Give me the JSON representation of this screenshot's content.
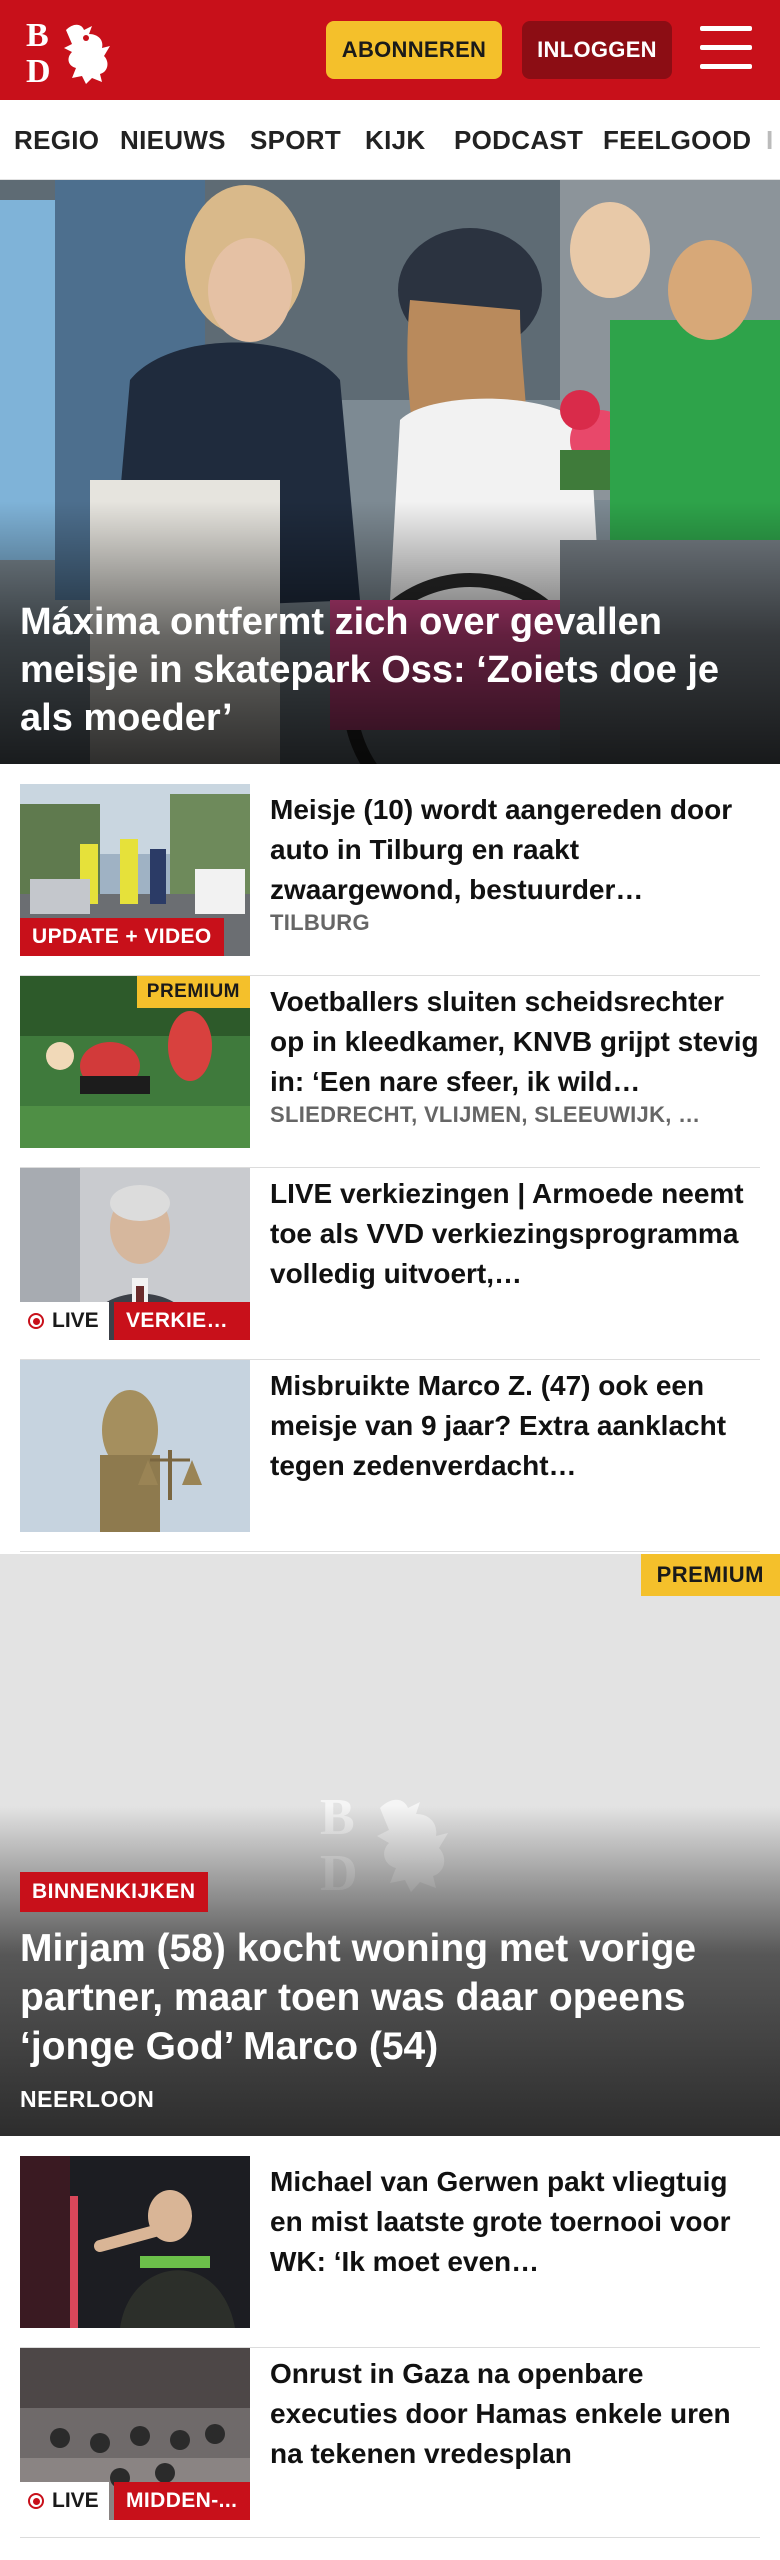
{
  "header": {
    "logo_alt": "BD",
    "subscribe_label": "ABONNEREN",
    "login_label": "INLOGGEN"
  },
  "nav": {
    "items": [
      "REGIO",
      "NIEUWS",
      "SPORT",
      "KIJK",
      "PODCAST",
      "FEELGOOD",
      "I"
    ]
  },
  "hero": {
    "title": "Máxima ontfermt zich over gevallen meisje in skatepark Oss: ‘Zoiets doe je als moeder’"
  },
  "articles": [
    {
      "title": "Meisje (10) wordt aangereden door auto in Tilburg en raakt zwaargewond, bestuurder…",
      "place": "TILBURG",
      "tag": "UPDATE + VIDEO"
    },
    {
      "title": "Voetballers sluiten scheidsrech­ter op in kleedkamer, KNVB grijpt stevig in: ‘Een nare sfeer, ik wild…",
      "place": "SLIEDRECHT, VLIJMEN, SLEEUWIJK, …",
      "premium": "PREMIUM"
    },
    {
      "title": "LIVE verkiezingen | Armoede neemt toe als VVD verkiezings­programma volledig uitvoert,…",
      "live": "LIVE",
      "tag": "VERKIEZ..."
    },
    {
      "title": "Misbruikte Marco Z. (47) ook een meisje van 9 jaar? Extra aanklacht tegen zedenverdacht…"
    }
  ],
  "feature": {
    "premium": "PREMIUM",
    "tag": "BINNENKIJKEN",
    "title": "Mirjam (58) kocht woning met vorige partner, maar toen was daar opeens ‘jonge God’ Marco (54)",
    "place": "NEERLOON"
  },
  "articles2": [
    {
      "title": "Michael van Gerwen pakt vliegtuig en mist laatste grote toernooi voor WK: ‘Ik moet even…"
    },
    {
      "title": "Onrust in Gaza na openbare executies door Hamas enkele uren na tekenen vredesplan",
      "live": "LIVE",
      "tag": "MIDDEN-..."
    }
  ],
  "colors": {
    "brand_red": "#c8101a",
    "premium_yellow": "#f4c02b",
    "login_dark_red": "#8c0d14"
  }
}
